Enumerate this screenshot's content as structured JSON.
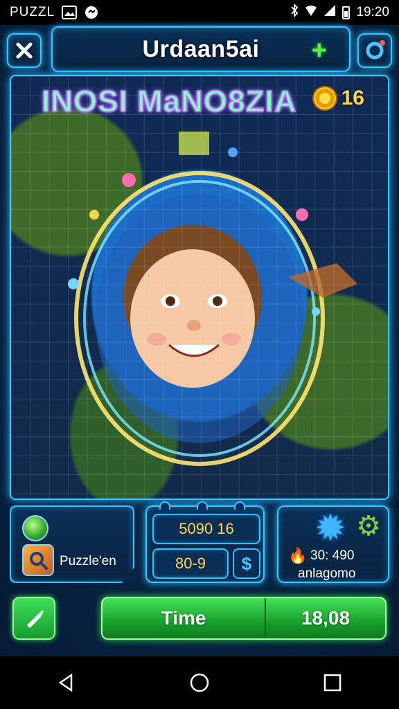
{
  "status_bar": {
    "app_name": "PUZZL",
    "time": "19:20",
    "icons": [
      "gallery-icon",
      "chat-icon",
      "bluetooth-icon",
      "wifi-icon",
      "signal-icon",
      "battery-icon"
    ]
  },
  "header": {
    "title": "Urdaan5ai",
    "plus_label": "+",
    "close_icon": "close-icon",
    "settings_icon": "settings-icon"
  },
  "board": {
    "headline": "INOSI MaNO8ZIA",
    "coin_count": "16"
  },
  "left_panel": {
    "label": "Puzzle'en"
  },
  "mid_panel": {
    "stat_top": "5090 16",
    "stat_bottom": "80-9",
    "dollar": "$"
  },
  "right_panel": {
    "line1": "30: 490",
    "line2": "anlagomo"
  },
  "bottom_bar": {
    "time_label": "Time",
    "time_value": "18,08"
  },
  "colors": {
    "accent_cyan": "#39c6ff",
    "accent_green": "#2fe04a",
    "coin_gold": "#ffd84a"
  }
}
